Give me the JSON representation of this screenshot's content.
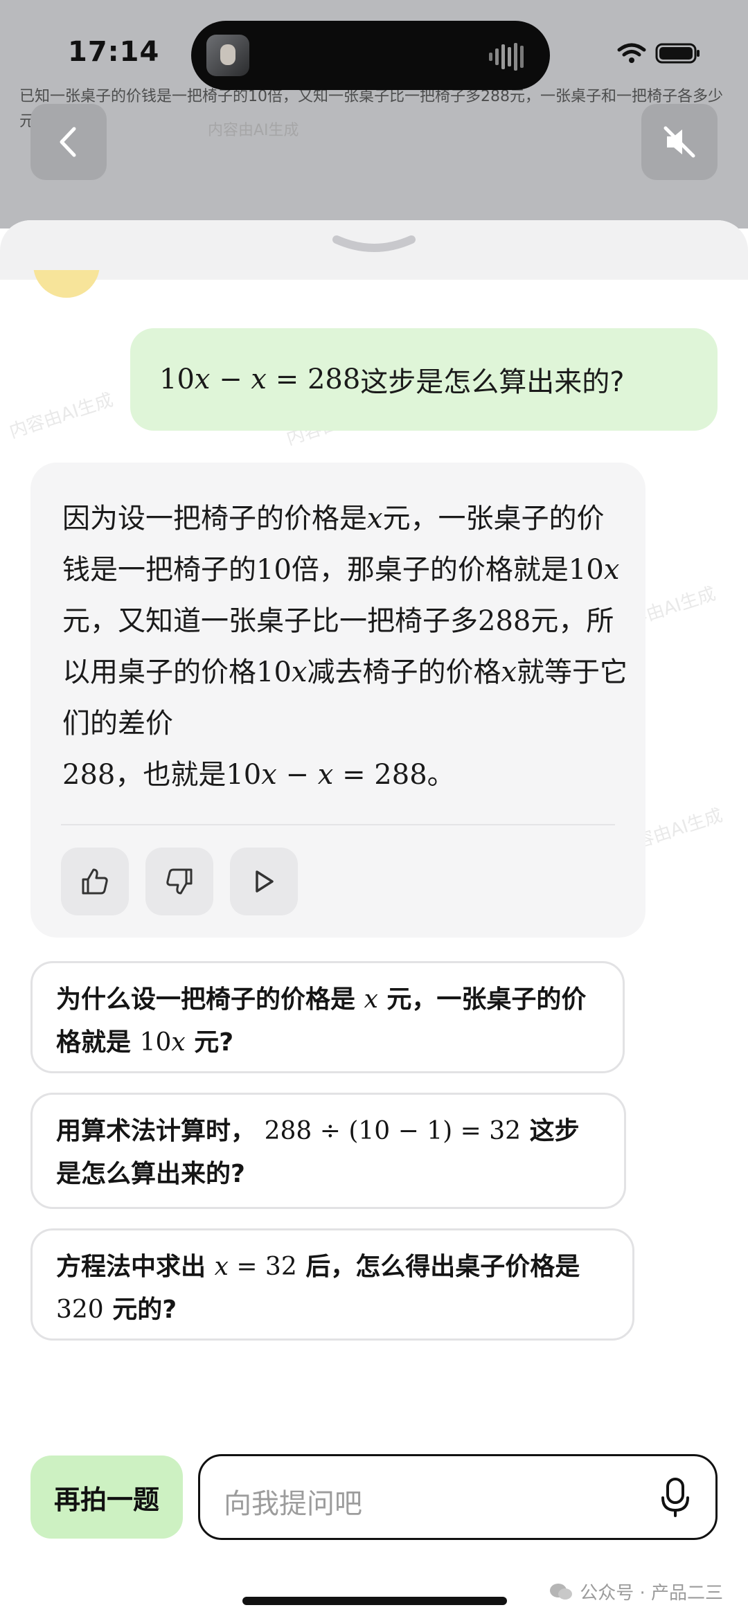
{
  "status_bar": {
    "time": "17:14"
  },
  "background": {
    "question_text": "已知一张桌子的价钱是一把椅子的10倍，又知一张桌子比一把椅子多288元，一张桌子和一把椅子各多少元?",
    "watermark": "内容由AI生成"
  },
  "conversation": {
    "user_message": {
      "math": {
        "n1": "10",
        "v1": "x",
        "op1": "−",
        "v2": "x",
        "eq": "=",
        "n2": "288"
      },
      "text": "这步是怎么算出来的?"
    },
    "ai_reply": {
      "p1": "因为设一把椅子的价格是",
      "v1": "x",
      "p2": "元，一张桌子的价钱是一把椅子的",
      "n1": "10",
      "p3": "倍，那桌子的价格就是",
      "n2": "10",
      "v2": "x",
      "p4": "元，又知道一张桌子比一把椅子多",
      "n3": "288",
      "p5": "元，所以用桌子的价格",
      "n4": "10",
      "v3": "x",
      "p6": "减去椅子的价格",
      "v4": "x",
      "p7": "就等于它们的差价",
      "n5": "288",
      "p8": "，也就是",
      "eq_n1": "10",
      "eq_v1": "x",
      "eq_op": "−",
      "eq_v2": "x",
      "eq_eq": "=",
      "eq_n2": "288",
      "p9": "。"
    },
    "feedback_icons": [
      "thumbs-up-icon",
      "thumbs-down-icon",
      "play-icon"
    ]
  },
  "suggestions": [
    {
      "t1": "为什么设一把椅子的价格是",
      "m1": "x",
      "t2": "元，一张桌子的价格就是",
      "m2n": "10",
      "m2v": "x",
      "t3": "元?"
    },
    {
      "t1": "用算术法计算时，",
      "m1": "288 ÷ (10 − 1) = 32",
      "t2": "这步是怎么算出来的?"
    },
    {
      "t1": "方程法中求出",
      "m1v": "x",
      "m1": " = 32",
      "t2": "后，怎么得出桌子价格是",
      "m2": "320",
      "t3": "元的?"
    }
  ],
  "bottom_bar": {
    "retake_label": "再拍一题",
    "input_placeholder": "向我提问吧"
  },
  "source_watermark": "公众号 · 产品二三"
}
